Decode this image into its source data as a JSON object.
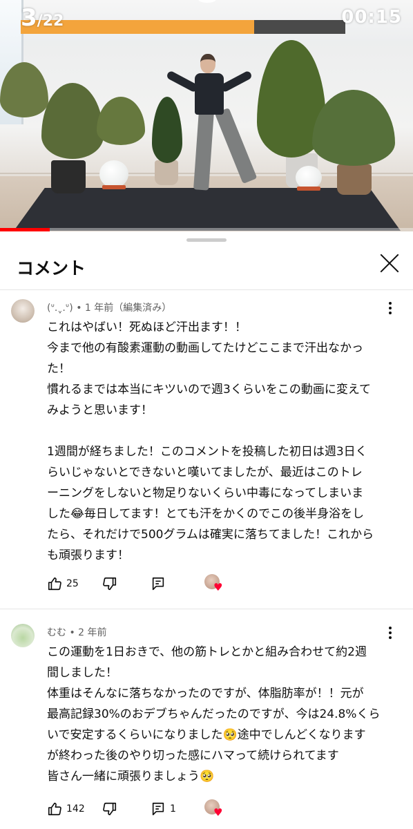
{
  "player": {
    "counter_current": "3",
    "counter_separator": "/",
    "counter_total": "22",
    "timer": "00:15",
    "progress_fraction": 0.72,
    "seek_fraction": 0.12,
    "accent_color": "#f3a43c"
  },
  "comments_panel": {
    "title": "コメント",
    "close_icon": "close-icon"
  },
  "comments": [
    {
      "author": "(ᐡ.ˬ.ᐡ)",
      "separator": "•",
      "time": "1 年前（編集済み）",
      "lines": [
        "これはやばい！死ぬほど汗出ます！！",
        "今まで他の有酸素運動の動画してたけどここまで汗出なかっ",
        "た！",
        "慣れるまでは本当にキツいので週3くらいをこの動画に変えて",
        "みようと思います！",
        "",
        "1週間が経ちました！このコメントを投稿した初日は週3日く",
        "らいじゃないとできないと嘆いてましたが、最近はこのトレ",
        "ーニングをしないと物足りないくらい中毒になってしまいま",
        "した😂毎日してます！とても汗をかくのでこの後半身浴をし",
        "たら、それだけで500グラムは確実に落ちてました！これから",
        "も頑張ります！"
      ],
      "likes": "25",
      "replies": ""
    },
    {
      "author": "むむ",
      "separator": "•",
      "time": "2 年前",
      "lines": [
        "この運動を1日おきで、他の筋トレとかと組み合わせて約2週",
        "間しました！",
        "体重はそんなに落ちなかったのですが、体脂肪率が！！元が",
        "最高記録30%のおデブちゃんだったのですが、今は24.8%くら",
        "いで安定するくらいになりました🥺途中でしんどくなります",
        "が終わった後のやり切った感にハマって続けられてます",
        "皆さん一緒に頑張りましょう🥺"
      ],
      "likes": "142",
      "replies": "1"
    }
  ],
  "icons": {
    "like": "thumb-up-icon",
    "dislike": "thumb-down-icon",
    "reply": "reply-icon",
    "heart": "creator-heart-icon"
  }
}
